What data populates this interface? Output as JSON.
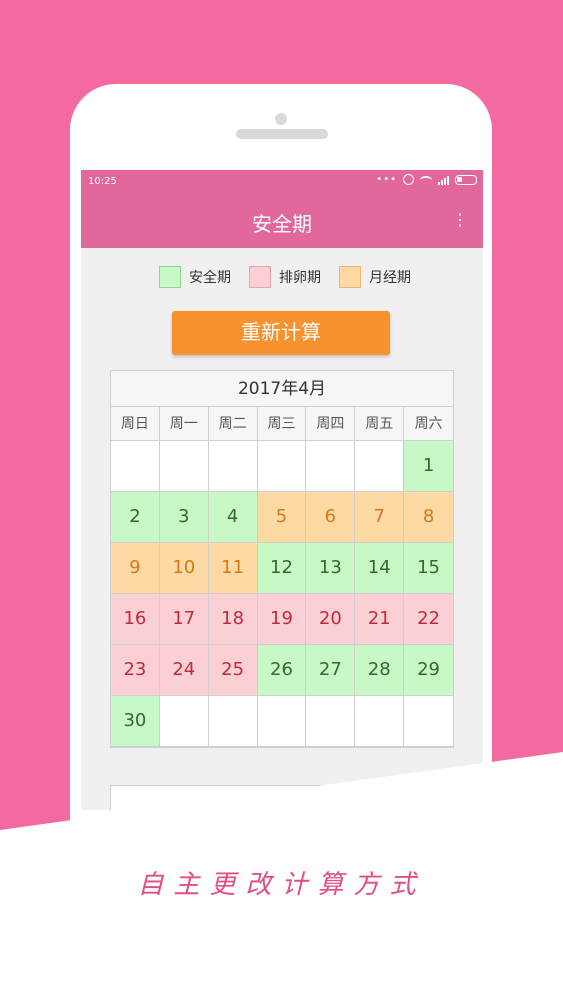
{
  "status": {
    "time": "10:25",
    "dots": "•••"
  },
  "appbar": {
    "title": "安全期",
    "more": "⋮"
  },
  "legend": [
    {
      "label": "安全期",
      "fill": "#c8f8c5",
      "border": "#8fd88a"
    },
    {
      "label": "排卵期",
      "fill": "#fbd0d5",
      "border": "#e8a4ad"
    },
    {
      "label": "月经期",
      "fill": "#fdd9a3",
      "border": "#e9b86a"
    }
  ],
  "button": {
    "label": "重新计算"
  },
  "calendar": {
    "title": "2017年4月",
    "weekdays": [
      "周日",
      "周一",
      "周二",
      "周三",
      "周四",
      "周五",
      "周六"
    ],
    "days": [
      {
        "d": "",
        "t": "empty"
      },
      {
        "d": "",
        "t": "empty"
      },
      {
        "d": "",
        "t": "empty"
      },
      {
        "d": "",
        "t": "empty"
      },
      {
        "d": "",
        "t": "empty"
      },
      {
        "d": "",
        "t": "empty"
      },
      {
        "d": "1",
        "t": "safe"
      },
      {
        "d": "2",
        "t": "safe"
      },
      {
        "d": "3",
        "t": "safe"
      },
      {
        "d": "4",
        "t": "safe"
      },
      {
        "d": "5",
        "t": "menses"
      },
      {
        "d": "6",
        "t": "menses"
      },
      {
        "d": "7",
        "t": "menses"
      },
      {
        "d": "8",
        "t": "menses"
      },
      {
        "d": "9",
        "t": "menses"
      },
      {
        "d": "10",
        "t": "menses"
      },
      {
        "d": "11",
        "t": "menses"
      },
      {
        "d": "12",
        "t": "safe"
      },
      {
        "d": "13",
        "t": "safe"
      },
      {
        "d": "14",
        "t": "safe"
      },
      {
        "d": "15",
        "t": "safe"
      },
      {
        "d": "16",
        "t": "ovulation"
      },
      {
        "d": "17",
        "t": "ovulation"
      },
      {
        "d": "18",
        "t": "ovulation"
      },
      {
        "d": "19",
        "t": "ovulation"
      },
      {
        "d": "20",
        "t": "ovulation"
      },
      {
        "d": "21",
        "t": "ovulation"
      },
      {
        "d": "22",
        "t": "ovulation"
      },
      {
        "d": "23",
        "t": "ovulation"
      },
      {
        "d": "24",
        "t": "ovulation"
      },
      {
        "d": "25",
        "t": "ovulation"
      },
      {
        "d": "26",
        "t": "safe"
      },
      {
        "d": "27",
        "t": "safe"
      },
      {
        "d": "28",
        "t": "safe"
      },
      {
        "d": "29",
        "t": "safe"
      },
      {
        "d": "30",
        "t": "safe"
      },
      {
        "d": "",
        "t": "empty"
      },
      {
        "d": "",
        "t": "empty"
      },
      {
        "d": "",
        "t": "empty"
      },
      {
        "d": "",
        "t": "empty"
      },
      {
        "d": "",
        "t": "empty"
      },
      {
        "d": "",
        "t": "empty"
      }
    ]
  },
  "tagline": "自主更改计算方式",
  "colors": {
    "background": "#f26aa0",
    "appbar": "#e2689b",
    "button": "#f7922e",
    "tagline": "#e24d86"
  }
}
